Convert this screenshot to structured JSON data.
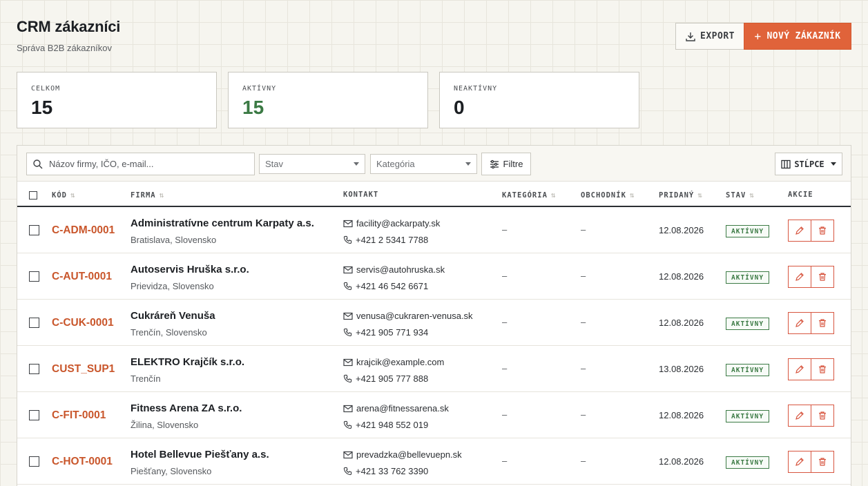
{
  "header": {
    "title": "CRM zákazníci",
    "subtitle": "Správa B2B zákazníkov",
    "export_label": "EXPORT",
    "new_label": "NOVÝ ZÁKAZNÍK"
  },
  "stats": [
    {
      "label": "CELKOM",
      "value": "15"
    },
    {
      "label": "AKTÍVNY",
      "value": "15"
    },
    {
      "label": "NEAKTÍVNY",
      "value": "0"
    }
  ],
  "toolbar": {
    "search_placeholder": "Názov firmy, IČO, e-mail...",
    "status_placeholder": "Stav",
    "category_placeholder": "Kategória",
    "filter_label": "Filtre",
    "columns_label": "STĹPCE"
  },
  "columns": {
    "code": "KÓD",
    "firm": "FIRMA",
    "contact": "KONTAKT",
    "category": "KATEGÓRIA",
    "dealer": "OBCHODNÍK",
    "added": "PRIDANÝ",
    "status": "STAV",
    "actions": "AKCIE"
  },
  "colors": {
    "accent": "#e0633a",
    "code": "#c9562b",
    "active": "#3b7a44",
    "danger": "#d7553f"
  },
  "rows": [
    {
      "code": "C-ADM-0001",
      "name": "Administratívne centrum Karpaty a.s.",
      "location": "Bratislava, Slovensko",
      "email": "facility@ackarpaty.sk",
      "phone": "+421 2 5341 7788",
      "category": "–",
      "dealer": "–",
      "date": "12.08.2026",
      "status": "AKTÍVNY"
    },
    {
      "code": "C-AUT-0001",
      "name": "Autoservis Hruška s.r.o.",
      "location": "Prievidza, Slovensko",
      "email": "servis@autohruska.sk",
      "phone": "+421 46 542 6671",
      "category": "–",
      "dealer": "–",
      "date": "12.08.2026",
      "status": "AKTÍVNY"
    },
    {
      "code": "C-CUK-0001",
      "name": "Cukráreň Venuša",
      "location": "Trenčín, Slovensko",
      "email": "venusa@cukraren-venusa.sk",
      "phone": "+421 905 771 934",
      "category": "–",
      "dealer": "–",
      "date": "12.08.2026",
      "status": "AKTÍVNY"
    },
    {
      "code": "CUST_SUP1",
      "name": "ELEKTRO Krajčík s.r.o.",
      "location": "Trenčín",
      "email": "krajcik@example.com",
      "phone": "+421 905 777 888",
      "category": "–",
      "dealer": "–",
      "date": "13.08.2026",
      "status": "AKTÍVNY"
    },
    {
      "code": "C-FIT-0001",
      "name": "Fitness Arena ZA s.r.o.",
      "location": "Žilina, Slovensko",
      "email": "arena@fitnessarena.sk",
      "phone": "+421 948 552 019",
      "category": "–",
      "dealer": "–",
      "date": "12.08.2026",
      "status": "AKTÍVNY"
    },
    {
      "code": "C-HOT-0001",
      "name": "Hotel Bellevue Piešťany a.s.",
      "location": "Piešťany, Slovensko",
      "email": "prevadzka@bellevuepn.sk",
      "phone": "+421 33 762 3390",
      "category": "–",
      "dealer": "–",
      "date": "12.08.2026",
      "status": "AKTÍVNY"
    }
  ]
}
